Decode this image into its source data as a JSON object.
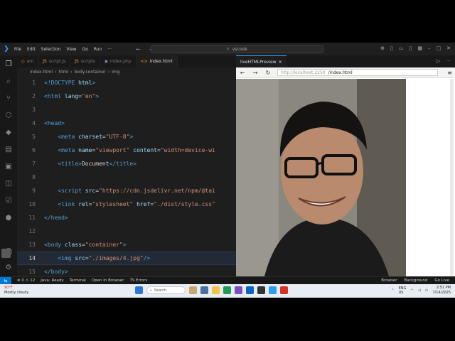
{
  "titlebar": {
    "menu": [
      "File",
      "Edit",
      "Selection",
      "View",
      "Go",
      "Run"
    ],
    "more": "···",
    "command_center": "vscode"
  },
  "tabs": [
    {
      "label": "am",
      "active": false
    },
    {
      "label": "script.js",
      "active": false
    },
    {
      "label": "scripts",
      "active": false
    },
    {
      "label": "index.php",
      "active": false
    },
    {
      "label": "index.html",
      "active": true
    }
  ],
  "breadcrumb": [
    "index.html",
    "html",
    "body.container",
    "img"
  ],
  "editor": {
    "current_line": 14,
    "lines": [
      {
        "n": "1",
        "tokens": [
          [
            "tag",
            "<!DOCTYPE "
          ],
          [
            "attr",
            "html"
          ],
          [
            "tag",
            ">"
          ]
        ]
      },
      {
        "n": "2",
        "tokens": [
          [
            "tag",
            "<html "
          ],
          [
            "attr",
            "lang"
          ],
          [
            "txt",
            "="
          ],
          [
            "str",
            "\"en\""
          ],
          [
            "tag",
            ">"
          ]
        ]
      },
      {
        "n": "3",
        "tokens": []
      },
      {
        "n": "4",
        "tokens": [
          [
            "tag",
            "<head>"
          ]
        ]
      },
      {
        "n": "5",
        "tokens": [
          [
            "txt",
            "    "
          ],
          [
            "tag",
            "<meta "
          ],
          [
            "attr",
            "charset"
          ],
          [
            "txt",
            "="
          ],
          [
            "str",
            "\"UTF-8\""
          ],
          [
            "tag",
            ">"
          ]
        ]
      },
      {
        "n": "6",
        "tokens": [
          [
            "txt",
            "    "
          ],
          [
            "tag",
            "<meta "
          ],
          [
            "attr",
            "name"
          ],
          [
            "txt",
            "="
          ],
          [
            "str",
            "\"viewport\""
          ],
          [
            "txt",
            " "
          ],
          [
            "attr",
            "content"
          ],
          [
            "txt",
            "="
          ],
          [
            "str",
            "\"width=device-wi"
          ]
        ]
      },
      {
        "n": "7",
        "tokens": [
          [
            "txt",
            "    "
          ],
          [
            "tag",
            "<title>"
          ],
          [
            "txt",
            "Document"
          ],
          [
            "tag",
            "</title>"
          ]
        ]
      },
      {
        "n": "8",
        "tokens": []
      },
      {
        "n": "9",
        "tokens": [
          [
            "txt",
            "    "
          ],
          [
            "tag",
            "<script "
          ],
          [
            "attr",
            "src"
          ],
          [
            "txt",
            "="
          ],
          [
            "str",
            "\"https://cdn.jsdelivr.net/npm/@tai"
          ]
        ]
      },
      {
        "n": "10",
        "tokens": [
          [
            "txt",
            "    "
          ],
          [
            "tag",
            "<link "
          ],
          [
            "attr",
            "rel"
          ],
          [
            "txt",
            "="
          ],
          [
            "str",
            "\"stylesheet\""
          ],
          [
            "txt",
            " "
          ],
          [
            "attr",
            "href"
          ],
          [
            "txt",
            "="
          ],
          [
            "str",
            "\"./dist/style.css\""
          ]
        ]
      },
      {
        "n": "11",
        "tokens": [
          [
            "tag",
            "</head>"
          ]
        ]
      },
      {
        "n": "12",
        "tokens": []
      },
      {
        "n": "13",
        "tokens": [
          [
            "tag",
            "<body "
          ],
          [
            "attr",
            "class"
          ],
          [
            "txt",
            "="
          ],
          [
            "str",
            "\"container\""
          ],
          [
            "tag",
            ">"
          ]
        ]
      },
      {
        "n": "14",
        "tokens": [
          [
            "txt",
            "    "
          ],
          [
            "tag",
            "<img "
          ],
          [
            "attr",
            "src"
          ],
          [
            "txt",
            "="
          ],
          [
            "str",
            "\"./images/4.jpg\""
          ],
          [
            "tag",
            "/>"
          ]
        ]
      },
      {
        "n": "15",
        "tokens": [
          [
            "tag",
            "</body>"
          ]
        ]
      }
    ]
  },
  "preview": {
    "tab_label": "liveHTMLPreview",
    "url_host": "http://localhost:2250",
    "url_path": "/index.html",
    "menu": "≡"
  },
  "statusbar": {
    "errors": "0",
    "warnings": "12",
    "items": [
      "Java: Ready",
      "Terminal",
      "Open In Browser",
      "TS Errors"
    ],
    "right": [
      "Browser",
      "Background",
      "Go Live"
    ]
  },
  "taskbar": {
    "weather_temp": "90°F",
    "weather_desc": "Mostly cloudy",
    "search": "Search",
    "lang": "ENG",
    "region": "US",
    "time": "2:51 PM",
    "date": "7/14/2025"
  }
}
